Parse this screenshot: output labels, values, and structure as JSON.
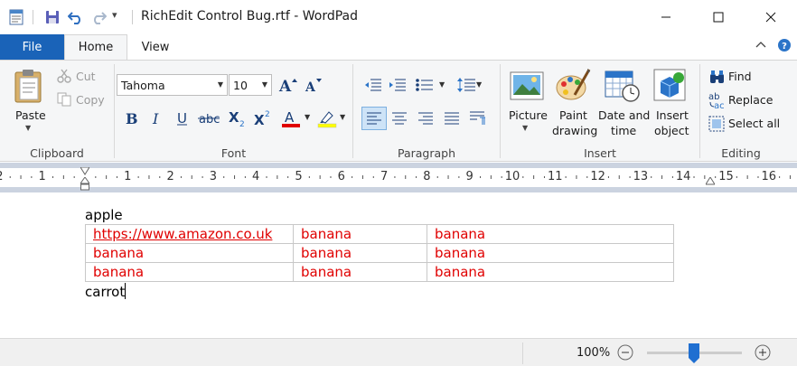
{
  "window": {
    "title": "RichEdit Control Bug.rtf - WordPad",
    "qa_dropdown": "▾"
  },
  "tabs": {
    "file": "File",
    "home": "Home",
    "view": "View"
  },
  "ribbon": {
    "clipboard": {
      "group": "Clipboard",
      "paste": "Paste",
      "cut": "Cut",
      "copy": "Copy"
    },
    "font": {
      "group": "Font",
      "family": "Tahoma",
      "size": "10"
    },
    "paragraph": {
      "group": "Paragraph"
    },
    "insert": {
      "group": "Insert",
      "picture": "Picture",
      "paint_1": "Paint",
      "paint_2": "drawing",
      "datetime_1": "Date and",
      "datetime_2": "time",
      "object_1": "Insert",
      "object_2": "object"
    },
    "editing": {
      "group": "Editing",
      "find": "Find",
      "replace": "Replace",
      "select_all": "Select all"
    }
  },
  "ruler": {
    "ticks": [
      "2",
      "1",
      "1",
      "2",
      "3",
      "4",
      "5",
      "6",
      "7",
      "8",
      "9",
      "10",
      "11",
      "12",
      "13",
      "14",
      "15",
      "16"
    ]
  },
  "document": {
    "before": "apple",
    "rows": [
      [
        "https://www.amazon.co.uk",
        "banana",
        "banana"
      ],
      [
        "banana",
        "banana",
        "banana"
      ],
      [
        "banana",
        "banana",
        "banana"
      ]
    ],
    "after": "carrot",
    "text_color": "#e00000"
  },
  "status": {
    "zoom": "100%",
    "zoom_level": 100
  },
  "colors": {
    "file_tab": "#1a63b8",
    "font_color_bar": "#e00000",
    "highlight_bar": "#ffff00",
    "selected_button": "#cde3f7"
  }
}
